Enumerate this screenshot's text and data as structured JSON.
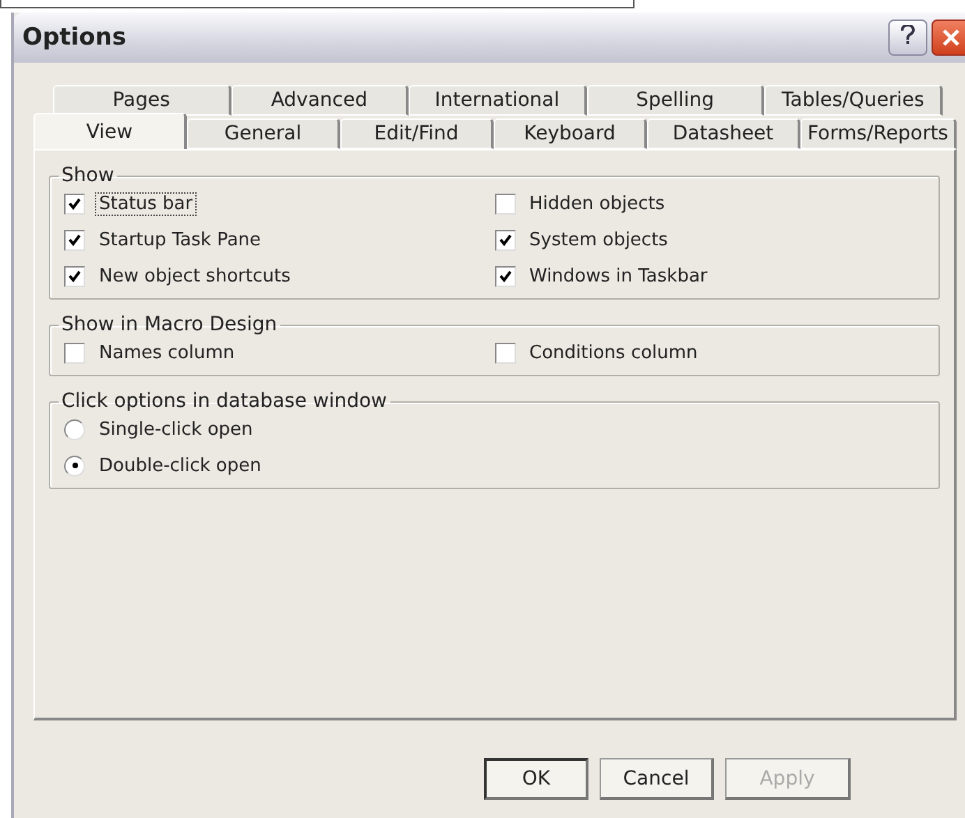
{
  "window": {
    "title": "Options"
  },
  "tab_rows": [
    [
      {
        "label": "Pages",
        "selected": false
      },
      {
        "label": "Advanced",
        "selected": false
      },
      {
        "label": "International",
        "selected": false
      },
      {
        "label": "Spelling",
        "selected": false
      },
      {
        "label": "Tables/Queries",
        "selected": false
      }
    ],
    [
      {
        "label": "View",
        "selected": true
      },
      {
        "label": "General",
        "selected": false
      },
      {
        "label": "Edit/Find",
        "selected": false
      },
      {
        "label": "Keyboard",
        "selected": false
      },
      {
        "label": "Datasheet",
        "selected": false
      },
      {
        "label": "Forms/Reports",
        "selected": false
      }
    ]
  ],
  "groups": [
    {
      "title": "Show",
      "items": [
        {
          "kind": "checkbox",
          "label": "Status bar",
          "checked": true,
          "focused": true
        },
        {
          "kind": "checkbox",
          "label": "Hidden objects",
          "checked": false,
          "focused": false
        },
        {
          "kind": "checkbox",
          "label": "Startup Task Pane",
          "checked": true,
          "focused": false
        },
        {
          "kind": "checkbox",
          "label": "System objects",
          "checked": true,
          "focused": false
        },
        {
          "kind": "checkbox",
          "label": "New object shortcuts",
          "checked": true,
          "focused": false
        },
        {
          "kind": "checkbox",
          "label": "Windows in Taskbar",
          "checked": true,
          "focused": false
        }
      ]
    },
    {
      "title": "Show in Macro Design",
      "items": [
        {
          "kind": "checkbox",
          "label": "Names column",
          "checked": false,
          "focused": false
        },
        {
          "kind": "checkbox",
          "label": "Conditions column",
          "checked": false,
          "focused": false
        }
      ]
    },
    {
      "title": "Click options in database window",
      "items": [
        {
          "kind": "radio",
          "label": "Single-click open",
          "checked": false,
          "focused": false
        },
        {
          "kind": "radio",
          "label": "Double-click open",
          "checked": true,
          "focused": false
        }
      ]
    }
  ],
  "buttons": [
    {
      "label": "OK",
      "default": true,
      "disabled": false
    },
    {
      "label": "Cancel",
      "default": false,
      "disabled": false
    },
    {
      "label": "Apply",
      "default": false,
      "disabled": true
    }
  ]
}
